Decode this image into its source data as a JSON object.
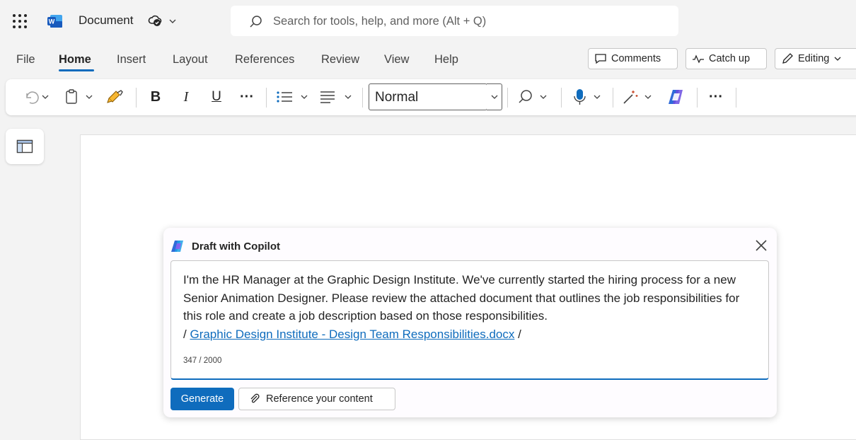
{
  "titlebar": {
    "app_name": "Document",
    "search_placeholder": "Search for tools, help, and more (Alt + Q)"
  },
  "menu": {
    "items": [
      "File",
      "Home",
      "Insert",
      "Layout",
      "References",
      "Review",
      "View",
      "Help"
    ],
    "active": "Home",
    "comments_label": "Comments",
    "catchup_label": "Catch up",
    "editing_label": "Editing"
  },
  "ribbon": {
    "bold": "B",
    "italic": "I",
    "underline": "U",
    "more": "···",
    "style_value": "Normal"
  },
  "copilot": {
    "title": "Draft with Copilot",
    "prompt_line1": "I'm the HR Manager at the Graphic Design Institute. We've currently started the hiring process for a new Senior Animation Designer. Please review the attached document that outlines the job responsibilities for this role and create a job description based on those responsibilities.",
    "prompt_prefix": "/",
    "prompt_link": "Graphic Design Institute - Design Team Responsibilities.docx",
    "prompt_suffix": "/",
    "counter": "347 / 2000",
    "generate_label": "Generate",
    "reference_label": "Reference your content"
  },
  "colors": {
    "accent": "#0f6cbd",
    "background": "#f3f3f3"
  }
}
